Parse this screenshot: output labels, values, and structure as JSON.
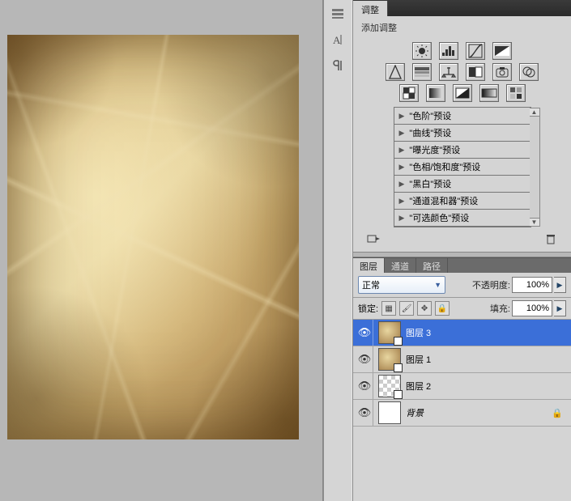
{
  "adjustments": {
    "tab_label": "调整",
    "subtitle": "添加调整",
    "row1_icons": [
      "brightness-contrast-icon",
      "levels-icon",
      "curves-icon",
      "exposure-icon"
    ],
    "row2_icons": [
      "vibrance-icon",
      "hue-sat-icon",
      "color-balance-icon",
      "bw-icon",
      "photo-filter-icon",
      "channel-mixer-icon"
    ],
    "row3_icons": [
      "invert-icon",
      "posterize-icon",
      "threshold-icon",
      "gradient-map-icon",
      "selective-color-icon"
    ],
    "presets": [
      "\"色阶\"预设",
      "\"曲线\"预设",
      "\"曝光度\"预设",
      "\"色相/饱和度\"预设",
      "\"黑白\"预设",
      "\"通道混和器\"预设",
      "\"可选颜色\"预设"
    ]
  },
  "layers_panel": {
    "tabs": {
      "layers": "图层",
      "channels": "通道",
      "paths": "路径"
    },
    "blend_mode": "正常",
    "opacity_label": "不透明度:",
    "opacity_value": "100%",
    "lock_label": "锁定:",
    "fill_label": "填充:",
    "fill_value": "100%",
    "layers": [
      {
        "name": "图层 3",
        "thumb": "tex",
        "selected": true
      },
      {
        "name": "图层 1",
        "thumb": "tex",
        "selected": false
      },
      {
        "name": "图层 2",
        "thumb": "trans",
        "selected": false
      },
      {
        "name": "背景",
        "thumb": "white",
        "selected": false,
        "bg": true
      }
    ]
  }
}
